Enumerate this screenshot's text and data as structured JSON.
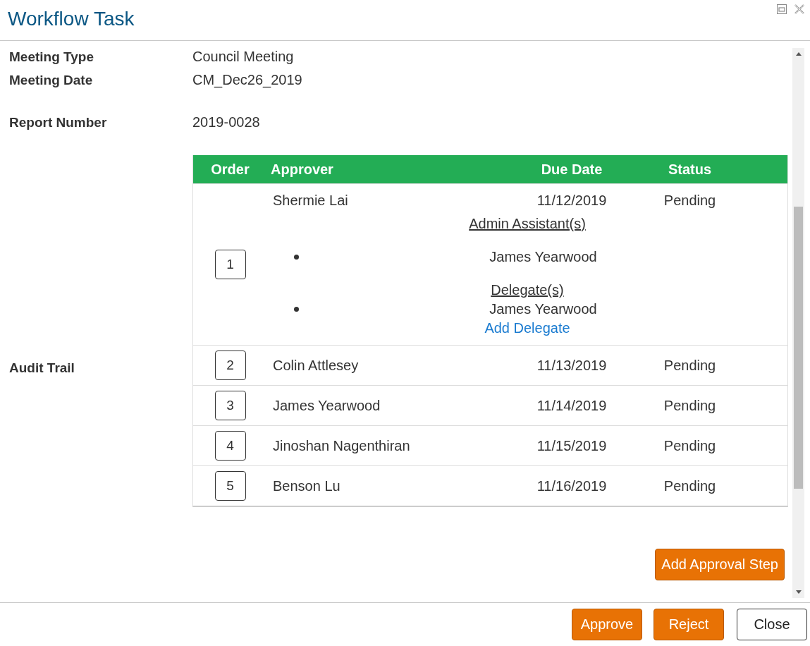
{
  "window": {
    "title": "Workflow Task"
  },
  "field_groups": [
    {
      "fields": [
        {
          "label": "Meeting Type",
          "value": "Council Meeting"
        },
        {
          "label": "Meeting Date",
          "value": "CM_Dec26_2019"
        }
      ]
    },
    {
      "fields": [
        {
          "label": "Report Number",
          "value": "2019-0028"
        }
      ]
    }
  ],
  "audit_trail": {
    "label": "Audit Trail",
    "table": {
      "columns": [
        "Order",
        "Approver",
        "Due Date",
        "Status"
      ],
      "rows": [
        {
          "order": "1",
          "approver": "Shermie Lai",
          "due_date": "11/12/2019",
          "status": "Pending",
          "admin_assistants": {
            "heading": "Admin Assistant(s)",
            "names": [
              "James Yearwood"
            ]
          },
          "delegates": {
            "heading": "Delegate(s)",
            "names": [
              "James Yearwood"
            ],
            "add_link": "Add Delegate"
          }
        },
        {
          "order": "2",
          "approver": "Colin Attlesey",
          "due_date": "11/13/2019",
          "status": "Pending"
        },
        {
          "order": "3",
          "approver": "James Yearwood",
          "due_date": "11/14/2019",
          "status": "Pending"
        },
        {
          "order": "4",
          "approver": "Jinoshan Nagenthiran",
          "due_date": "11/15/2019",
          "status": "Pending"
        },
        {
          "order": "5",
          "approver": "Benson Lu",
          "due_date": "11/16/2019",
          "status": "Pending"
        }
      ]
    },
    "add_button": "Add Approval Step"
  },
  "footer_buttons": [
    {
      "label": "Approve",
      "kind": "primary"
    },
    {
      "label": "Reject",
      "kind": "primary"
    },
    {
      "label": "Close",
      "kind": "secondary"
    }
  ]
}
